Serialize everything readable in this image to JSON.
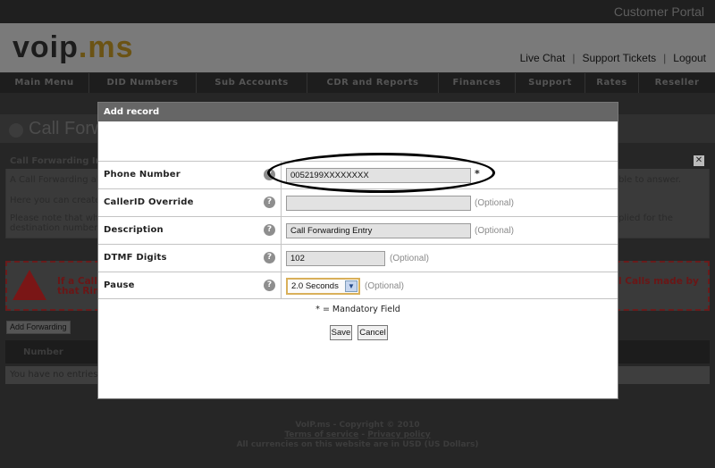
{
  "portal_title": "Customer Portal",
  "logo": {
    "main": "voip",
    "suffix": ".ms"
  },
  "top_links": [
    "Live Chat",
    "Support Tickets",
    "Logout"
  ],
  "nav": [
    "Main Menu",
    "DID Numbers",
    "Sub Accounts",
    "CDR and Reports",
    "Finances",
    "Support",
    "Rates",
    "Reseller"
  ],
  "page_title": "Call Forw",
  "info_box": {
    "title": "Call Forwarding In",
    "close": "✕",
    "line1_left": "A Call Forwarding al",
    "line1_right": "ble to answer.",
    "line2_left": "Here you can create",
    "line3_left": "Please note that whe",
    "line3_right": "plied for the",
    "line4_left": "destination number t"
  },
  "warning": {
    "line1_left": "If a Call",
    "line2_left": "that Ring",
    "line1_right": "l Calls made by"
  },
  "add_forwarding_button": "Add Forwarding",
  "table": {
    "header": "Number",
    "empty_text": "You have no entries"
  },
  "footer": {
    "copyright": "VoIP.ms - Copyright © 2010",
    "terms": "Terms of service",
    "dash": " - ",
    "privacy": "Privacy policy",
    "currency": "All currencies on this website are in USD (US Dollars)"
  },
  "modal": {
    "title": "Add record",
    "fields": {
      "phone_number": {
        "label": "Phone Number",
        "value": "0052199XXXXXXXX",
        "marker": "*"
      },
      "callerid_override": {
        "label": "CallerID Override",
        "value": "",
        "note": "(Optional)"
      },
      "description": {
        "label": "Description",
        "value": "Call Forwarding Entry",
        "note": "(Optional)"
      },
      "dtmf_digits": {
        "label": "DTMF Digits",
        "value": "102",
        "note": "(Optional)"
      },
      "pause": {
        "label": "Pause",
        "value": "2.0 Seconds",
        "note": "(Optional)"
      }
    },
    "help_glyph": "?",
    "mandatory_note": "* = Mandatory Field",
    "save_label": "Save",
    "cancel_label": "Cancel"
  }
}
